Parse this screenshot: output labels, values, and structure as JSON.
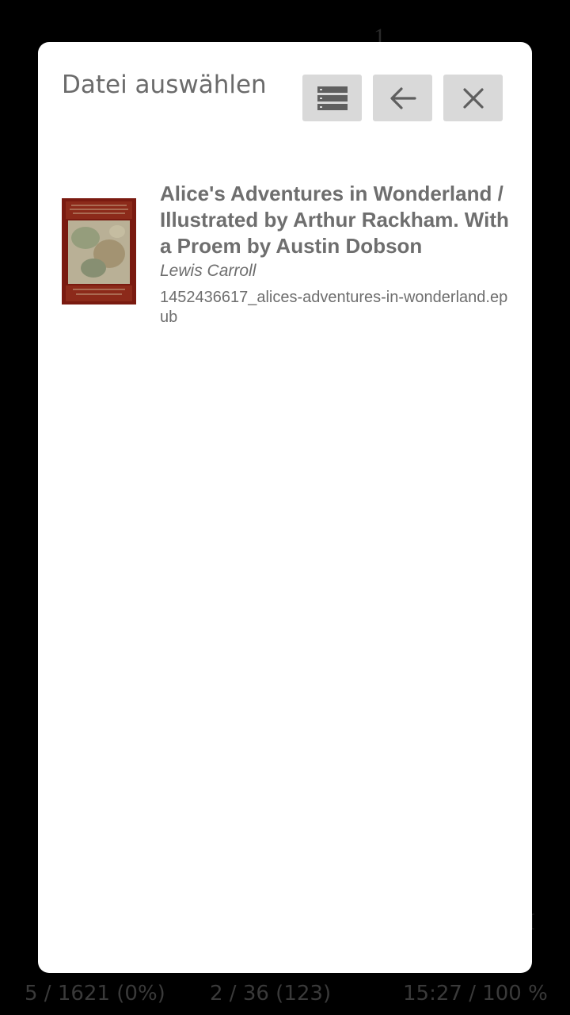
{
  "dialog": {
    "title": "Datei auswählen",
    "buttons": {
      "list_icon": "list-view-icon",
      "back_icon": "arrow-back-icon",
      "close_icon": "close-icon"
    }
  },
  "files": [
    {
      "title": "Alice's Adventures in Wonderland / Illustrated by Arthur Rackham. With a Proem by Austin Dobson",
      "author": "Lewis Carroll",
      "filename": "1452436617_alices-adventures-in-wonderland.epub",
      "cover_icon": "book-cover-thumbnail"
    }
  ],
  "status_bar": {
    "page_progress": "5 / 1621 (0%)",
    "chapter_progress": "2 / 36 (123)",
    "time_battery": "15:27 / 100 %"
  },
  "colors": {
    "dialog_bg": "#ffffff",
    "button_bg": "#d9d9d9",
    "text_gray": "#6e6e6e",
    "cover_red": "#7a1a10"
  }
}
